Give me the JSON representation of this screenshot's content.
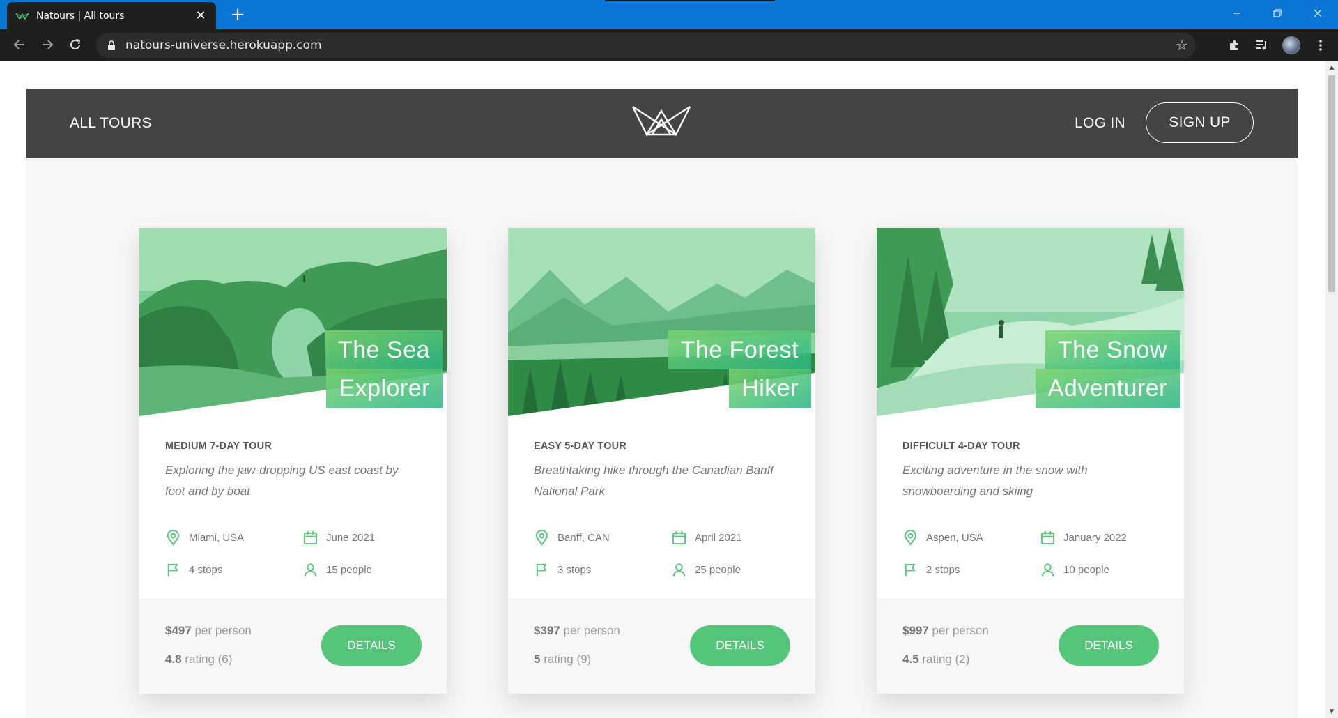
{
  "browser": {
    "tab_title": "Natours | All tours",
    "tab_close": "✕",
    "new_tab": "+",
    "url": "natours-universe.herokuapp.com",
    "icons": [
      "natours-favicon",
      "back-icon",
      "forward-icon",
      "reload-icon",
      "lock-icon",
      "star-icon",
      "extensions-icon",
      "media-icon",
      "profile-avatar",
      "menu-icon",
      "minimize-icon",
      "restore-icon",
      "close-icon"
    ]
  },
  "nav": {
    "all_tours": "All tours",
    "login": "Log in",
    "signup": "Sign up"
  },
  "colors": {
    "primary_green": "#55c57a",
    "header_bg": "#444444",
    "browser_blue": "#0b76d6"
  },
  "tours": [
    {
      "title_line1": "The Sea",
      "title_line2": "Explorer",
      "subheading": "Medium 7-day tour",
      "summary": "Exploring the jaw-dropping US east coast by foot and by boat",
      "location": "Miami, USA",
      "date": "June 2021",
      "stops": "4 stops",
      "people": "15 people",
      "price": "$497",
      "price_suffix": " per person",
      "rating": "4.8",
      "rating_suffix": " rating (6)",
      "button": "Details"
    },
    {
      "title_line1": "The Forest",
      "title_line2": "Hiker",
      "subheading": "Easy 5-day tour",
      "summary": "Breathtaking hike through the Canadian Banff National Park",
      "location": "Banff, CAN",
      "date": "April 2021",
      "stops": "3 stops",
      "people": "25 people",
      "price": "$397",
      "price_suffix": " per person",
      "rating": "5",
      "rating_suffix": " rating (9)",
      "button": "Details"
    },
    {
      "title_line1": "The Snow",
      "title_line2": "Adventurer",
      "subheading": "Difficult 4-day tour",
      "summary": "Exciting adventure in the snow with snowboarding and skiing",
      "location": "Aspen, USA",
      "date": "January 2022",
      "stops": "2 stops",
      "people": "10 people",
      "price": "$997",
      "price_suffix": " per person",
      "rating": "4.5",
      "rating_suffix": " rating (2)",
      "button": "Details"
    }
  ]
}
